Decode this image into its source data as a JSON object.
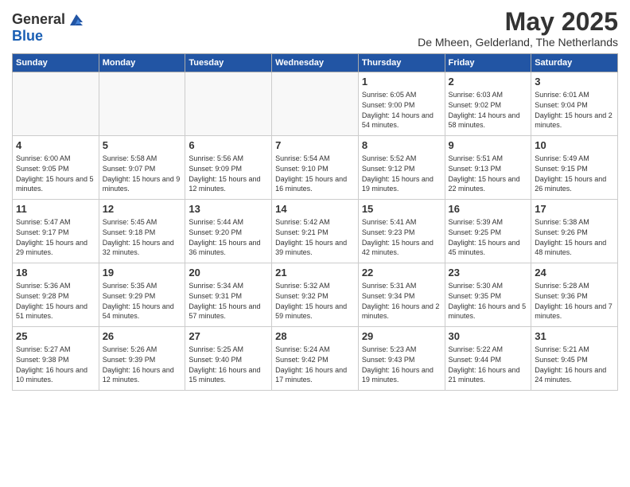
{
  "logo": {
    "general": "General",
    "blue": "Blue"
  },
  "title": "May 2025",
  "location": "De Mheen, Gelderland, The Netherlands",
  "headers": [
    "Sunday",
    "Monday",
    "Tuesday",
    "Wednesday",
    "Thursday",
    "Friday",
    "Saturday"
  ],
  "rows": [
    [
      {
        "day": "",
        "info": ""
      },
      {
        "day": "",
        "info": ""
      },
      {
        "day": "",
        "info": ""
      },
      {
        "day": "",
        "info": ""
      },
      {
        "day": "1",
        "info": "Sunrise: 6:05 AM\nSunset: 9:00 PM\nDaylight: 14 hours and 54 minutes."
      },
      {
        "day": "2",
        "info": "Sunrise: 6:03 AM\nSunset: 9:02 PM\nDaylight: 14 hours and 58 minutes."
      },
      {
        "day": "3",
        "info": "Sunrise: 6:01 AM\nSunset: 9:04 PM\nDaylight: 15 hours and 2 minutes."
      }
    ],
    [
      {
        "day": "4",
        "info": "Sunrise: 6:00 AM\nSunset: 9:05 PM\nDaylight: 15 hours and 5 minutes."
      },
      {
        "day": "5",
        "info": "Sunrise: 5:58 AM\nSunset: 9:07 PM\nDaylight: 15 hours and 9 minutes."
      },
      {
        "day": "6",
        "info": "Sunrise: 5:56 AM\nSunset: 9:09 PM\nDaylight: 15 hours and 12 minutes."
      },
      {
        "day": "7",
        "info": "Sunrise: 5:54 AM\nSunset: 9:10 PM\nDaylight: 15 hours and 16 minutes."
      },
      {
        "day": "8",
        "info": "Sunrise: 5:52 AM\nSunset: 9:12 PM\nDaylight: 15 hours and 19 minutes."
      },
      {
        "day": "9",
        "info": "Sunrise: 5:51 AM\nSunset: 9:13 PM\nDaylight: 15 hours and 22 minutes."
      },
      {
        "day": "10",
        "info": "Sunrise: 5:49 AM\nSunset: 9:15 PM\nDaylight: 15 hours and 26 minutes."
      }
    ],
    [
      {
        "day": "11",
        "info": "Sunrise: 5:47 AM\nSunset: 9:17 PM\nDaylight: 15 hours and 29 minutes."
      },
      {
        "day": "12",
        "info": "Sunrise: 5:45 AM\nSunset: 9:18 PM\nDaylight: 15 hours and 32 minutes."
      },
      {
        "day": "13",
        "info": "Sunrise: 5:44 AM\nSunset: 9:20 PM\nDaylight: 15 hours and 36 minutes."
      },
      {
        "day": "14",
        "info": "Sunrise: 5:42 AM\nSunset: 9:21 PM\nDaylight: 15 hours and 39 minutes."
      },
      {
        "day": "15",
        "info": "Sunrise: 5:41 AM\nSunset: 9:23 PM\nDaylight: 15 hours and 42 minutes."
      },
      {
        "day": "16",
        "info": "Sunrise: 5:39 AM\nSunset: 9:25 PM\nDaylight: 15 hours and 45 minutes."
      },
      {
        "day": "17",
        "info": "Sunrise: 5:38 AM\nSunset: 9:26 PM\nDaylight: 15 hours and 48 minutes."
      }
    ],
    [
      {
        "day": "18",
        "info": "Sunrise: 5:36 AM\nSunset: 9:28 PM\nDaylight: 15 hours and 51 minutes."
      },
      {
        "day": "19",
        "info": "Sunrise: 5:35 AM\nSunset: 9:29 PM\nDaylight: 15 hours and 54 minutes."
      },
      {
        "day": "20",
        "info": "Sunrise: 5:34 AM\nSunset: 9:31 PM\nDaylight: 15 hours and 57 minutes."
      },
      {
        "day": "21",
        "info": "Sunrise: 5:32 AM\nSunset: 9:32 PM\nDaylight: 15 hours and 59 minutes."
      },
      {
        "day": "22",
        "info": "Sunrise: 5:31 AM\nSunset: 9:34 PM\nDaylight: 16 hours and 2 minutes."
      },
      {
        "day": "23",
        "info": "Sunrise: 5:30 AM\nSunset: 9:35 PM\nDaylight: 16 hours and 5 minutes."
      },
      {
        "day": "24",
        "info": "Sunrise: 5:28 AM\nSunset: 9:36 PM\nDaylight: 16 hours and 7 minutes."
      }
    ],
    [
      {
        "day": "25",
        "info": "Sunrise: 5:27 AM\nSunset: 9:38 PM\nDaylight: 16 hours and 10 minutes."
      },
      {
        "day": "26",
        "info": "Sunrise: 5:26 AM\nSunset: 9:39 PM\nDaylight: 16 hours and 12 minutes."
      },
      {
        "day": "27",
        "info": "Sunrise: 5:25 AM\nSunset: 9:40 PM\nDaylight: 16 hours and 15 minutes."
      },
      {
        "day": "28",
        "info": "Sunrise: 5:24 AM\nSunset: 9:42 PM\nDaylight: 16 hours and 17 minutes."
      },
      {
        "day": "29",
        "info": "Sunrise: 5:23 AM\nSunset: 9:43 PM\nDaylight: 16 hours and 19 minutes."
      },
      {
        "day": "30",
        "info": "Sunrise: 5:22 AM\nSunset: 9:44 PM\nDaylight: 16 hours and 21 minutes."
      },
      {
        "day": "31",
        "info": "Sunrise: 5:21 AM\nSunset: 9:45 PM\nDaylight: 16 hours and 24 minutes."
      }
    ]
  ]
}
